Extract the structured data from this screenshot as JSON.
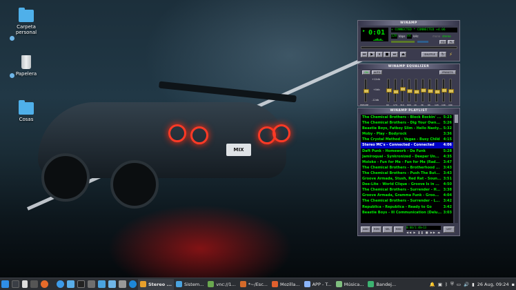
{
  "desktop": {
    "icons": [
      {
        "label_line1": "Carpeta",
        "label_line2": "personal",
        "icon": "folder-icon"
      },
      {
        "label_line1": "Papelera",
        "label_line2": "",
        "icon": "trash-icon"
      },
      {
        "label_line1": "Cosas",
        "label_line2": "",
        "icon": "folder-icon"
      }
    ],
    "wallpaper_plate": "MIX"
  },
  "winamp": {
    "main": {
      "title": "WINAMP",
      "time": "0:01",
      "song_title": "+ CONNECTED * CONNECTED +4:06",
      "kbps": "128",
      "khz": "44",
      "kbps_label": "kbps",
      "khz_label": "kHz",
      "mono_label": "mono",
      "stereo_label": "stereo",
      "eq_button": "EQ",
      "pl_button": "PL",
      "shuffle_label": "SHUFFLE"
    },
    "equalizer": {
      "title": "WINAMP EQUALIZER",
      "on_label": "ON",
      "auto_label": "AUTO",
      "presets_label": "PRESETS",
      "db_top": "+12db",
      "db_mid": "+0db",
      "db_bottom": "-12db",
      "preamp_label": "PREAMP",
      "bands": [
        "60",
        "170",
        "310",
        "600",
        "1K",
        "3K",
        "6K",
        "12K",
        "14K",
        "16K"
      ],
      "band_levels": [
        0.55,
        0.45,
        0.6,
        0.5,
        0.45,
        0.55,
        0.5,
        0.45,
        0.55,
        0.5
      ],
      "preamp_level": 0.5
    },
    "playlist": {
      "title": "WINAMP PLAYLIST",
      "items": [
        {
          "title": "The Chemical Brothers - Block Rockin' ...",
          "time": "5:23"
        },
        {
          "title": "The Chemical Brothers - Dig Your Own...",
          "time": "5:26"
        },
        {
          "title": "Beastie Boys, Fatboy Slim - Hello Nasty...",
          "time": "5:32"
        },
        {
          "title": "Moby - Play - Bodyrock",
          "time": "3:36"
        },
        {
          "title": "The Crystal Method - Vegas - Busy Child",
          "time": "4:15"
        },
        {
          "title": "Stereo MC's - Connected - Connected",
          "time": "4:06"
        },
        {
          "title": "Daft Punk - Homework - Da Funk",
          "time": "5:28"
        },
        {
          "title": "Jamiroquai - Synkronized - Deeper Un...",
          "time": "4:35"
        },
        {
          "title": "Moloko - Fun for Me - Fun for Me (Rad...",
          "time": "3:47"
        },
        {
          "title": "The Chemical Brothers - Brotherhood ...",
          "time": "3:43"
        },
        {
          "title": "The Chemical Brothers - Push The But...",
          "time": "3:43"
        },
        {
          "title": "Groove Armada, Stush, Red Rat - Soun...",
          "time": "3:51"
        },
        {
          "title": "Dee-Lite - World Clique - Groove Is in ...",
          "time": "4:50"
        },
        {
          "title": "The Chemical Brothers - Surrender - H...",
          "time": "3:38"
        },
        {
          "title": "Groove Armada, Gramma Funk - Groo...",
          "time": "4:04"
        },
        {
          "title": "The Chemical Brothers - Surrender - L...",
          "time": "3:42"
        },
        {
          "title": "Republica - Republica - Ready to Go",
          "time": "3:42"
        },
        {
          "title": "Beastie Boys - Ill Communication (Delu...",
          "time": "3:03"
        }
      ],
      "current_index": 5,
      "buttons": [
        "ADD",
        "REM",
        "SEL",
        "MISC"
      ],
      "list_button": "LIST",
      "time_display": "0:00/1:48+13"
    }
  },
  "taskbar": {
    "tasks": [
      {
        "label": "Stereo ...",
        "active": true,
        "color": "#e8a02b"
      },
      {
        "label": "Sistem...",
        "active": false,
        "color": "#4aa3df"
      },
      {
        "label": "vnc://1...",
        "active": false,
        "color": "#6aa84f"
      },
      {
        "label": "*~/Esc...",
        "active": false,
        "color": "#d46a2a"
      },
      {
        "label": "Mozilla...",
        "active": false,
        "color": "#e0602e"
      },
      {
        "label": "APP - T...",
        "active": false,
        "color": "#8ab4f8"
      },
      {
        "label": "Música...",
        "active": false,
        "color": "#7fbf7f"
      },
      {
        "label": "Bandej...",
        "active": false,
        "color": "#3cb371"
      }
    ],
    "clock": "26 Aug, 09:24"
  }
}
